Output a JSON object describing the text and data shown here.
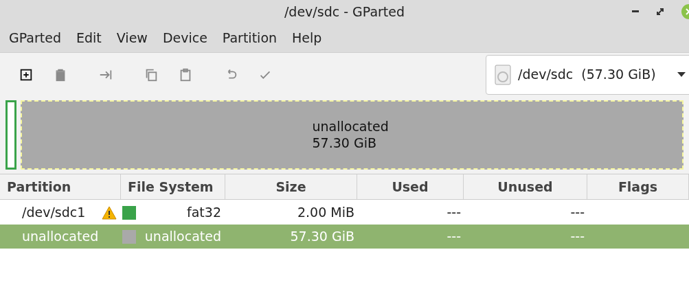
{
  "window": {
    "title": "/dev/sdc - GParted"
  },
  "menu": [
    "GParted",
    "Edit",
    "View",
    "Device",
    "Partition",
    "Help"
  ],
  "toolbar": [
    {
      "kind": "new",
      "disabled": false
    },
    {
      "kind": "delete",
      "disabled": true
    },
    {
      "kind": "resize",
      "disabled": true
    },
    {
      "kind": "copy",
      "disabled": true
    },
    {
      "kind": "paste",
      "disabled": true
    },
    {
      "kind": "undo",
      "disabled": true
    },
    {
      "kind": "apply",
      "disabled": true
    }
  ],
  "device": {
    "label": "/dev/sdc  (57.30 GiB)"
  },
  "disk_map": {
    "name": "unallocated",
    "size": "57.30 GiB"
  },
  "table": {
    "columns": [
      "Partition",
      "File System",
      "Size",
      "Used",
      "Unused",
      "Flags"
    ],
    "rows": [
      {
        "partition": "/dev/sdc1",
        "warning": true,
        "color": "#3aa34a",
        "file_system": "fat32",
        "size": "2.00 MiB",
        "used": "---",
        "unused": "---",
        "selected": false
      },
      {
        "partition": "unallocated",
        "warning": false,
        "color": "#a9a9a9",
        "file_system": "unallocated",
        "size": "57.30 GiB",
        "used": "---",
        "unused": "---",
        "selected": true
      }
    ]
  }
}
